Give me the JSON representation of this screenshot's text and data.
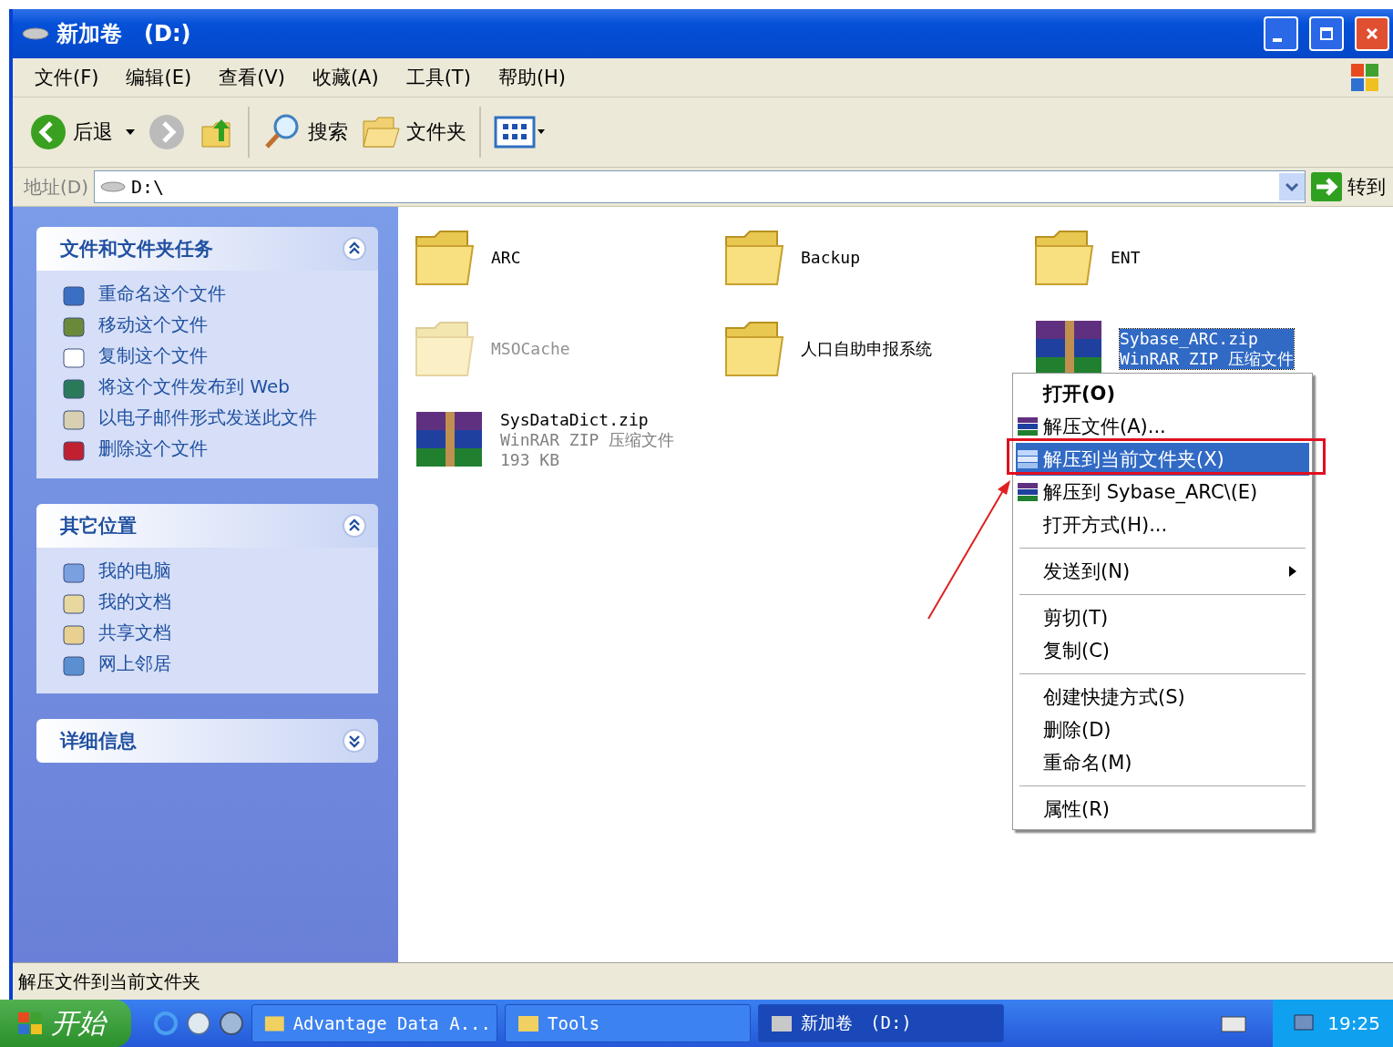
{
  "window": {
    "title": "新加卷　(D:)"
  },
  "menu_bar": [
    "文件(F)",
    "编辑(E)",
    "查看(V)",
    "收藏(A)",
    "工具(T)",
    "帮助(H)"
  ],
  "toolbar": {
    "back": "后退",
    "search": "搜索",
    "folders": "文件夹"
  },
  "address_bar": {
    "label": "地址(D)",
    "value": "D:\\",
    "go": "转到"
  },
  "sidebar": [
    {
      "title": "文件和文件夹任务",
      "expanded": true,
      "items": [
        "重命名这个文件",
        "移动这个文件",
        "复制这个文件",
        "将这个文件发布到 Web",
        "以电子邮件形式发送此文件",
        "删除这个文件"
      ]
    },
    {
      "title": "其它位置",
      "expanded": true,
      "items": [
        "我的电脑",
        "我的文档",
        "共享文档",
        "网上邻居"
      ]
    },
    {
      "title": "详细信息",
      "expanded": false
    }
  ],
  "files": [
    {
      "kind": "folder",
      "name": "ARC",
      "hidden": false,
      "selected": false
    },
    {
      "kind": "folder",
      "name": "Backup",
      "hidden": false,
      "selected": false
    },
    {
      "kind": "folder",
      "name": "ENT",
      "hidden": false,
      "selected": false
    },
    {
      "kind": "folder",
      "name": "MSOCache",
      "hidden": true,
      "selected": false
    },
    {
      "kind": "folder",
      "name": "人口自助申报系统",
      "hidden": false,
      "selected": false
    },
    {
      "kind": "archive",
      "name": "Sybase_ARC.zip",
      "type": "WinRAR ZIP 压缩文件",
      "hidden": false,
      "selected": true
    },
    {
      "kind": "archive",
      "name": "SysDataDict.zip",
      "type": "WinRAR ZIP 压缩文件",
      "size": "193 KB",
      "hidden": false,
      "selected": false
    }
  ],
  "context_menu": [
    [
      {
        "label": "打开(O)",
        "bold": true,
        "kind": "plain",
        "selected": false,
        "submenu": false
      },
      {
        "label": "解压文件(A)...",
        "bold": false,
        "kind": "archive",
        "selected": false,
        "submenu": false
      },
      {
        "label": "解压到当前文件夹(X)",
        "bold": false,
        "kind": "archive",
        "selected": true,
        "submenu": false
      },
      {
        "label": "解压到 Sybase_ARC\\(E)",
        "bold": false,
        "kind": "archive",
        "selected": false,
        "submenu": false
      },
      {
        "label": "打开方式(H)...",
        "bold": false,
        "kind": "plain",
        "selected": false,
        "submenu": false
      }
    ],
    [
      {
        "label": "发送到(N)",
        "bold": false,
        "kind": "plain",
        "selected": false,
        "submenu": true
      }
    ],
    [
      {
        "label": "剪切(T)",
        "bold": false,
        "kind": "plain",
        "selected": false,
        "submenu": false
      },
      {
        "label": "复制(C)",
        "bold": false,
        "kind": "plain",
        "selected": false,
        "submenu": false
      }
    ],
    [
      {
        "label": "创建快捷方式(S)",
        "bold": false,
        "kind": "plain",
        "selected": false,
        "submenu": false
      },
      {
        "label": "删除(D)",
        "bold": false,
        "kind": "plain",
        "selected": false,
        "submenu": false
      },
      {
        "label": "重命名(M)",
        "bold": false,
        "kind": "plain",
        "selected": false,
        "submenu": false
      }
    ],
    [
      {
        "label": "属性(R)",
        "bold": false,
        "kind": "plain",
        "selected": false,
        "submenu": false
      }
    ]
  ],
  "status_bar": "解压文件到当前文件夹",
  "taskbar": {
    "start": "开始",
    "tasks": [
      {
        "label": "Advantage Data A...",
        "selected": false
      },
      {
        "label": "Tools",
        "selected": false
      },
      {
        "label": "新加卷　(D:)",
        "selected": true
      }
    ],
    "clock": "19:25"
  }
}
